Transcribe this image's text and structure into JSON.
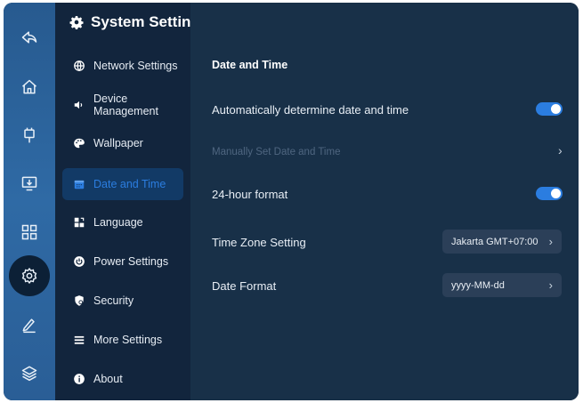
{
  "header": {
    "title": "System Settings",
    "icon": "gear-icon"
  },
  "rail": {
    "items": [
      {
        "name": "back-icon"
      },
      {
        "name": "home-icon"
      },
      {
        "name": "tools-icon"
      },
      {
        "name": "screen-share-icon"
      },
      {
        "name": "apps-grid-icon"
      },
      {
        "name": "settings-gear-icon",
        "active": true
      },
      {
        "name": "pen-icon"
      },
      {
        "name": "layers-icon"
      }
    ]
  },
  "menu": {
    "items": [
      {
        "label": "Network Settings",
        "icon": "globe-icon"
      },
      {
        "label": "Device\nManagement",
        "icon": "speaker-icon"
      },
      {
        "label": "Wallpaper",
        "icon": "palette-icon"
      },
      {
        "label": "Date and Time",
        "icon": "calendar-icon",
        "active": true
      },
      {
        "label": "Language",
        "icon": "language-icon"
      },
      {
        "label": "Power Settings",
        "icon": "power-icon"
      },
      {
        "label": "Security",
        "icon": "shield-icon"
      },
      {
        "label": "More Settings",
        "icon": "list-icon"
      },
      {
        "label": "About",
        "icon": "info-icon"
      }
    ]
  },
  "content": {
    "section_title": "Date and Time",
    "rows": {
      "auto_date": {
        "label": "Automatically determine date and time",
        "toggle_on": true
      },
      "manual_set": {
        "label": "Manually Set Date and Time",
        "disabled": true
      },
      "hour24": {
        "label": "24-hour format",
        "toggle_on": true
      },
      "timezone": {
        "label": "Time Zone Setting",
        "value": "Jakarta GMT+07:00"
      },
      "date_format": {
        "label": "Date Format",
        "value": "yyyy-MM-dd"
      }
    }
  },
  "colors": {
    "accent": "#2b7de0",
    "rail": "#2f6aa5",
    "menu_bg": "#12253d",
    "content_bg": "#183048"
  }
}
